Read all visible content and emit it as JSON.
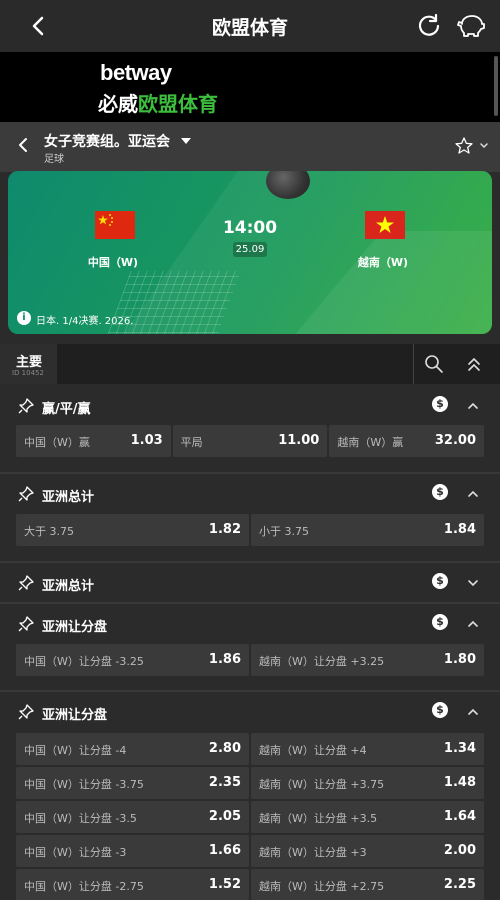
{
  "topbar": {
    "title": "欧盟体育"
  },
  "banner": {
    "brand_top": "betway",
    "brand_bottom_white": "必威",
    "brand_bottom_green": "欧盟体育"
  },
  "competition": {
    "title": "女子竞赛组。亚运会",
    "sport": "足球"
  },
  "match": {
    "home_team": "中国（W)",
    "away_team": "越南（W)",
    "time": "14:00",
    "date": "25.09",
    "info": "日本. 1/4决赛. 2026."
  },
  "tabs": {
    "main_label": "主要",
    "id_label": "ID 10452"
  },
  "markets": [
    {
      "title": "赢/平/赢",
      "cashout": "$",
      "expanded": true,
      "rows": [
        [
          {
            "label": "中国（W）赢",
            "price": "1.03"
          },
          {
            "label": "平局",
            "price": "11.00"
          },
          {
            "label": "越南（W）赢",
            "price": "32.00"
          }
        ]
      ]
    },
    {
      "title": "亚洲总计",
      "cashout": "$",
      "expanded": true,
      "rows": [
        [
          {
            "label": "大于 3.75",
            "price": "1.82"
          },
          {
            "label": "小于 3.75",
            "price": "1.84"
          }
        ]
      ]
    },
    {
      "title": "亚洲总计",
      "cashout": "$",
      "expanded": false,
      "rows": []
    },
    {
      "title": "亚洲让分盘",
      "cashout": "$",
      "expanded": true,
      "rows": [
        [
          {
            "label": "中国（W）让分盘 -3.25",
            "price": "1.86"
          },
          {
            "label": "越南（W）让分盘 +3.25",
            "price": "1.80"
          }
        ]
      ]
    },
    {
      "title": "亚洲让分盘",
      "cashout": "$",
      "expanded": true,
      "rows": [
        [
          {
            "label": "中国（W）让分盘 -4",
            "price": "2.80"
          },
          {
            "label": "越南（W）让分盘 +4",
            "price": "1.34"
          }
        ],
        [
          {
            "label": "中国（W）让分盘 -3.75",
            "price": "2.35"
          },
          {
            "label": "越南（W）让分盘 +3.75",
            "price": "1.48"
          }
        ],
        [
          {
            "label": "中国（W）让分盘 -3.5",
            "price": "2.05"
          },
          {
            "label": "越南（W）让分盘 +3.5",
            "price": "1.64"
          }
        ],
        [
          {
            "label": "中国（W）让分盘 -3",
            "price": "1.66"
          },
          {
            "label": "越南（W）让分盘 +3",
            "price": "2.00"
          }
        ],
        [
          {
            "label": "中国（W）让分盘 -2.75",
            "price": "1.52"
          },
          {
            "label": "越南（W）让分盘 +2.75",
            "price": "2.25"
          }
        ]
      ]
    }
  ]
}
